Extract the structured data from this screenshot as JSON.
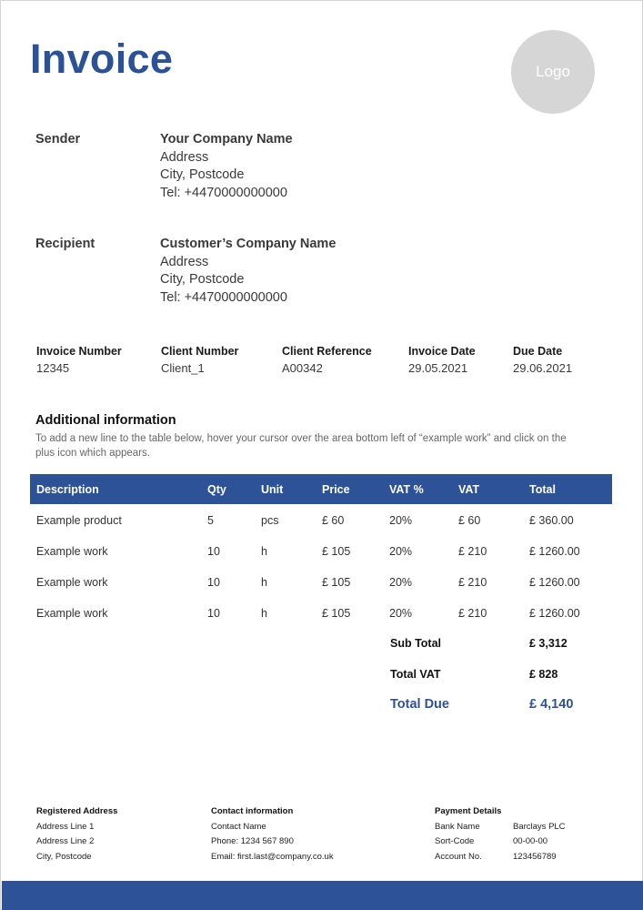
{
  "header": {
    "title": "Invoice",
    "logo_label": "Logo"
  },
  "sender": {
    "label": "Sender",
    "company": "Your Company Name",
    "address": "Address",
    "city": "City, Postcode",
    "tel": "Tel: +4470000000000"
  },
  "recipient": {
    "label": "Recipient",
    "company": "Customer’s Company Name",
    "address": "Address",
    "city": "City, Postcode",
    "tel": "Tel: +4470000000000"
  },
  "meta": [
    {
      "label": "Invoice Number",
      "value": "12345"
    },
    {
      "label": "Client Number",
      "value": "Client_1"
    },
    {
      "label": "Client Reference",
      "value": "A00342"
    },
    {
      "label": "Invoice Date",
      "value": "29.05.2021"
    },
    {
      "label": "Due Date",
      "value": "29.06.2021"
    }
  ],
  "additional": {
    "title": "Additional information",
    "text": "To add a new line to the table below, hover your cursor over the area bottom left of “example work” and click on the plus icon which appears."
  },
  "table": {
    "columns": [
      "Description",
      "Qty",
      "Unit",
      "Price",
      "VAT %",
      "VAT",
      "Total"
    ],
    "rows": [
      [
        "Example product",
        "5",
        "pcs",
        "£ 60",
        "20%",
        "£ 60",
        "£ 360.00"
      ],
      [
        "Example work",
        "10",
        "h",
        "£ 105",
        "20%",
        "£ 210",
        "£ 1260.00"
      ],
      [
        "Example work",
        "10",
        "h",
        "£ 105",
        "20%",
        "£ 210",
        "£ 1260.00"
      ],
      [
        "Example work",
        "10",
        "h",
        "£ 105",
        "20%",
        "£ 210",
        "£ 1260.00"
      ]
    ]
  },
  "summary": {
    "subtotal_label": "Sub Total",
    "subtotal_value": "£ 3,312",
    "vat_label": "Total VAT",
    "vat_value": "£ 828",
    "due_label": "Total Due",
    "due_value": "£ 4,140"
  },
  "footer": {
    "registered": {
      "title": "Registered Address",
      "lines": [
        "Address Line 1",
        "Address Line 2",
        "City, Postcode"
      ]
    },
    "contact": {
      "title": "Contact information",
      "lines": [
        "Contact Name",
        "Phone: 1234 567 890",
        "Email: first.last@company.co.uk"
      ]
    },
    "payment": {
      "title": "Payment Details",
      "rows": [
        {
          "label": "Bank Name",
          "value": "Barclays PLC"
        },
        {
          "label": "Sort-Code",
          "value": "00-00-00"
        },
        {
          "label": "Account No.",
          "value": "123456789"
        }
      ]
    }
  },
  "colors": {
    "accent": "#2d5297",
    "logo_bg": "#d6d6d6"
  }
}
